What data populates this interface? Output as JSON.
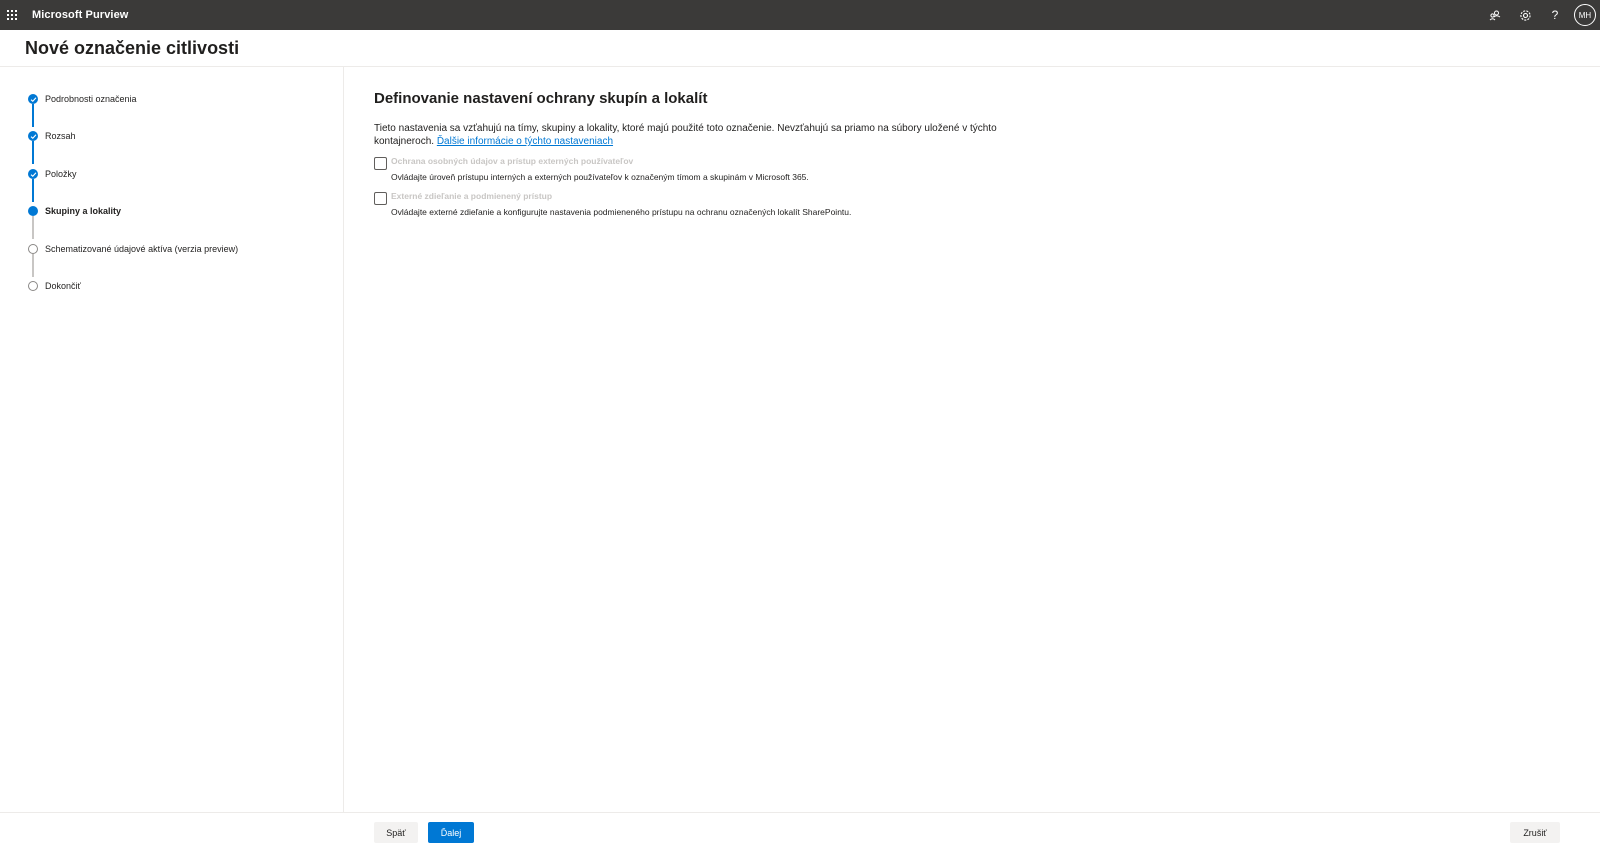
{
  "app": {
    "name": "Microsoft Purview",
    "avatar_initials": "MH"
  },
  "topbar_icons": [
    "waffle-icon",
    "people-icon",
    "gear-icon",
    "help-icon"
  ],
  "page": {
    "title": "Nové označenie citlivosti"
  },
  "steps": [
    {
      "label": "Podrobnosti označenia",
      "state": "done"
    },
    {
      "label": "Rozsah",
      "state": "done"
    },
    {
      "label": "Položky",
      "state": "done"
    },
    {
      "label": "Skupiny a lokality",
      "state": "current"
    },
    {
      "label": "Schematizované údajové aktíva (verzia preview)",
      "state": "pending"
    },
    {
      "label": "Dokončiť",
      "state": "pending"
    }
  ],
  "main": {
    "title": "Definovanie nastavení ochrany skupín a lokalít",
    "description": "Tieto nastavenia sa vzťahujú na tímy, skupiny a lokality, ktoré majú použité toto označenie. Nevzťahujú sa priamo na súbory uložené v týchto kontajneroch.",
    "link": "Ďalšie informácie o týchto nastaveniach",
    "options": [
      {
        "title": "Ochrana osobných údajov a prístup externých používateľov",
        "description": "Ovládajte úroveň prístupu interných a externých používateľov k označeným tímom a skupinám v Microsoft 365.",
        "checked": false
      },
      {
        "title": "Externé zdieľanie a podmienený prístup",
        "description": "Ovládajte externé zdieľanie a konfigurujte nastavenia podmieneného prístupu na ochranu označených lokalít SharePointu.",
        "checked": false
      }
    ]
  },
  "footer": {
    "back": "Späť",
    "next": "Ďalej",
    "cancel": "Zrušiť"
  },
  "colors": {
    "accent": "#0078d4",
    "topbar": "#3b3a39",
    "disabled_text": "#c8c6c4"
  }
}
